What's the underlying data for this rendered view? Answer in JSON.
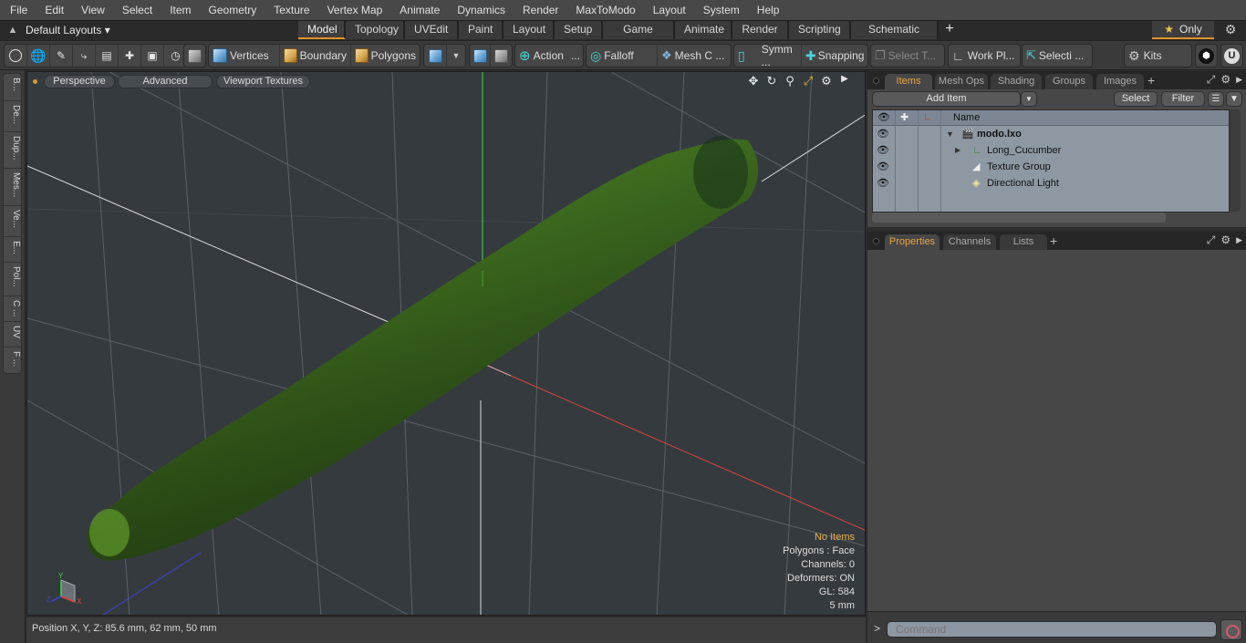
{
  "menubar": {
    "items": [
      "File",
      "Edit",
      "View",
      "Select",
      "Item",
      "Geometry",
      "Texture",
      "Vertex Map",
      "Animate",
      "Dynamics",
      "Render",
      "MaxToModo",
      "Layout",
      "System",
      "Help"
    ]
  },
  "layoutbar": {
    "layouts_dropdown": "Default Layouts ▾",
    "tabs": [
      {
        "label": "Model",
        "active": true
      },
      {
        "label": "Topology"
      },
      {
        "label": "UVEdit"
      },
      {
        "label": "Paint"
      },
      {
        "label": "Layout"
      },
      {
        "label": "Setup"
      },
      {
        "label": "Game Tools"
      },
      {
        "label": "Animate"
      },
      {
        "label": "Render"
      },
      {
        "label": "Scripting"
      },
      {
        "label": "Schematic Fusion"
      }
    ],
    "add_tab": "+",
    "only_label": "Only",
    "accent_color": "#e0922a"
  },
  "toolbar": {
    "vertices": "Vertices",
    "boundary": "Boundary",
    "polygons": "Polygons",
    "action": "Action",
    "action_more": "...",
    "falloff": "Falloff",
    "mesh_c": "Mesh C ...",
    "symm": "Symm ...",
    "snapping": "Snapping",
    "select_t": "Select T...",
    "work_pl": "Work Pl...",
    "selecti": "Selecti ...",
    "kits": "Kits"
  },
  "left_tabs": [
    "B...",
    "De...",
    "Dup...",
    "Mes...",
    "Ve...",
    "E...",
    "Pol...",
    "C ...",
    "UV",
    "F ..."
  ],
  "viewport": {
    "view_mode": "Perspective",
    "shading": "Advanced",
    "textures": "Viewport Textures",
    "info": {
      "selection": "No Items",
      "polygons": "Polygons : Face",
      "channels": "Channels: 0",
      "deformers": "Deformers: ON",
      "gl": "GL: 584",
      "grid": "5 mm"
    },
    "axis_labels": {
      "x": "X",
      "y": "Y",
      "z": "Z"
    }
  },
  "statusbar": {
    "position": "Position X, Y, Z:   85.6 mm, 62 mm, 50 mm"
  },
  "items_panel": {
    "tabs": [
      {
        "label": "Items",
        "active": true
      },
      {
        "label": "Mesh Ops"
      },
      {
        "label": "Shading"
      },
      {
        "label": "Groups"
      },
      {
        "label": "Images"
      }
    ],
    "add_item": "Add Item",
    "select": "Select",
    "filter": "Filter",
    "column_name": "Name",
    "tree": [
      {
        "label": "modo.lxo",
        "type": "scene",
        "expanded": true
      },
      {
        "label": "Long_Cucumber",
        "type": "mesh",
        "expanded": false
      },
      {
        "label": "Texture Group",
        "type": "texture-group"
      },
      {
        "label": "Directional Light",
        "type": "light"
      }
    ]
  },
  "properties_panel": {
    "tabs": [
      {
        "label": "Properties",
        "active": true
      },
      {
        "label": "Channels"
      },
      {
        "label": "Lists"
      }
    ]
  },
  "command": {
    "prompt": ">",
    "placeholder": "Command"
  }
}
